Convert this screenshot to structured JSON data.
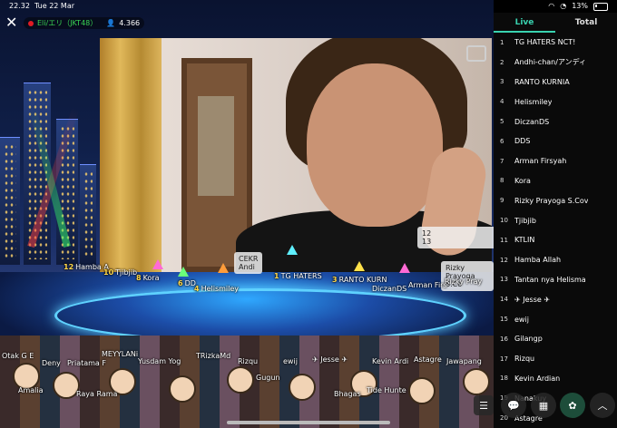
{
  "status": {
    "time": "22.32",
    "date": "Tue 22 Mar",
    "battery": "13%"
  },
  "header": {
    "member_name": "Eli/エリ（JKT48）",
    "viewers": "4.366",
    "close_icon": "close-icon",
    "camera_icon": "camera-icon"
  },
  "tabs": [
    {
      "label": "Live",
      "active": true
    },
    {
      "label": "Total",
      "active": false
    }
  ],
  "ranking": [
    {
      "rank": "1",
      "name": "TG HATERS NCT!"
    },
    {
      "rank": "2",
      "name": "Andhi-chan/アンディ"
    },
    {
      "rank": "3",
      "name": "RANTO KURNIA"
    },
    {
      "rank": "4",
      "name": "Helismiley"
    },
    {
      "rank": "5",
      "name": "DiczanDS"
    },
    {
      "rank": "6",
      "name": "DDS"
    },
    {
      "rank": "7",
      "name": "Arman Firsyah"
    },
    {
      "rank": "8",
      "name": "Kora"
    },
    {
      "rank": "9",
      "name": "Rizky Prayoga S.Cov"
    },
    {
      "rank": "10",
      "name": "Tjibjib"
    },
    {
      "rank": "11",
      "name": "KTLIN"
    },
    {
      "rank": "12",
      "name": "Hamba Allah"
    },
    {
      "rank": "13",
      "name": "Tantan nya Helisma"
    },
    {
      "rank": "14",
      "name": "✈ Jesse ✈"
    },
    {
      "rank": "15",
      "name": "ewij"
    },
    {
      "rank": "16",
      "name": "Gilangp"
    },
    {
      "rank": "17",
      "name": "Rizqu"
    },
    {
      "rank": "18",
      "name": "Kevin Ardian"
    },
    {
      "rank": "19",
      "name": "Nanakuy"
    },
    {
      "rank": "20",
      "name": "Astagre"
    }
  ],
  "avatar_labels": {
    "a1": {
      "rank": "12",
      "name": "Hamba A"
    },
    "a2": {
      "rank": "10",
      "name": "Tjibjib"
    },
    "a3": {
      "rank": "8",
      "name": "Kora"
    },
    "a4": {
      "rank": "6",
      "name": "DD"
    },
    "a5": {
      "rank": "4",
      "name": "Helismiley"
    },
    "a6": {
      "rank": "1",
      "name": "TG HATERS"
    },
    "a7": {
      "rank": "3",
      "name": "RANTO KURN"
    },
    "a8": {
      "rank": "",
      "name": "DiczanDS"
    },
    "a9": {
      "rank": "",
      "name": "Arman Firs"
    },
    "a10": {
      "rank": "",
      "name": "Rizky Pray"
    },
    "c1": {
      "rank": "",
      "name": "Otak G E"
    },
    "c2": {
      "rank": "",
      "name": "MEYYLANi"
    },
    "c3": {
      "rank": "",
      "name": "TRizkaMd"
    },
    "c4": {
      "rank": "",
      "name": "Deny"
    },
    "c5": {
      "rank": "",
      "name": "Priatama F"
    },
    "c6": {
      "rank": "",
      "name": "Yusdam Yog"
    },
    "c7": {
      "rank": "",
      "name": "Rizqu"
    },
    "c8": {
      "rank": "",
      "name": "ewij"
    },
    "c9": {
      "rank": "",
      "name": "✈ Jesse ✈"
    },
    "c10": {
      "rank": "",
      "name": "Kevin Ardi"
    },
    "c11": {
      "rank": "",
      "name": "Astagre"
    },
    "c12": {
      "rank": "",
      "name": "Jawapang"
    },
    "c13": {
      "rank": "",
      "name": "Amalia"
    },
    "c14": {
      "rank": "",
      "name": "Raya Rama"
    },
    "c15": {
      "rank": "",
      "name": "Bhagas"
    },
    "c16": {
      "rank": "",
      "name": "Gugun"
    },
    "c17": {
      "rank": "",
      "name": "Tide Hunte"
    }
  },
  "cards": {
    "card1": {
      "title": "CEKR",
      "line2": "Andi"
    },
    "card2": {
      "title": "12",
      "line2": "13"
    },
    "card3": {
      "title": "Rizky Prayoga",
      "line2": "S.Co"
    }
  },
  "buttons": [
    {
      "name": "comment-list-button",
      "icon": "list-icon"
    },
    {
      "name": "chat-button",
      "icon": "chat-bubble-icon"
    },
    {
      "name": "grid-button",
      "icon": "grid-icon"
    },
    {
      "name": "gift-button",
      "icon": "ribbon-icon"
    },
    {
      "name": "collapse-button",
      "icon": "chevron-up-icon"
    }
  ]
}
